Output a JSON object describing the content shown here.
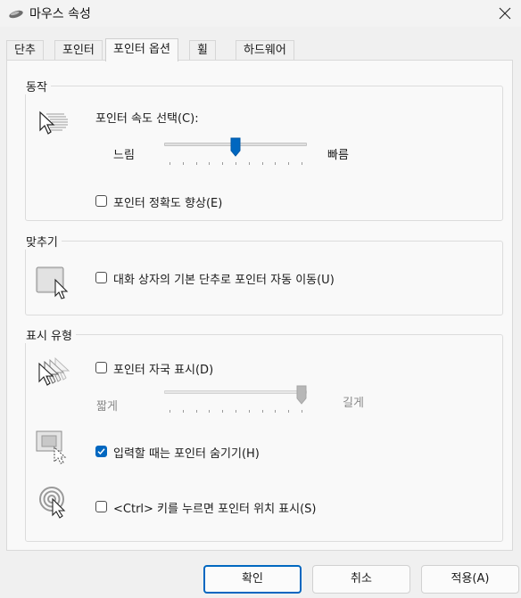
{
  "window": {
    "title": "마우스 속성",
    "title_icon": "mouse-icon",
    "close_icon": "close-icon"
  },
  "tabs": [
    {
      "label": "단추"
    },
    {
      "label": "포인터"
    },
    {
      "label": "포인터 옵션",
      "active": true
    },
    {
      "label": "휠"
    },
    {
      "label": "하드웨어"
    }
  ],
  "motion": {
    "title": "동작",
    "speed_label": "포인터 속도 선택(C):",
    "slow_label": "느림",
    "fast_label": "빠름",
    "speed_level": 0.5,
    "precision_label": "포인터 정확도 향상(E)",
    "precision_checked": false
  },
  "snap_to": {
    "title": "맞추기",
    "label": "대화 상자의 기본 단추로 포인터 자동 이동(U)",
    "checked": false
  },
  "visibility": {
    "title": "표시 유형",
    "trails_label": "포인터 자국 표시(D)",
    "trails_checked": false,
    "short_label": "짧게",
    "long_label": "길게",
    "trails_level": 1.0,
    "hide_label": "입력할 때는 포인터 숨기기(H)",
    "hide_checked": true,
    "ctrl_label": "<Ctrl> 키를 누르면 포인터 위치 표시(S)",
    "ctrl_checked": false
  },
  "buttons": {
    "ok": "확인",
    "cancel": "취소",
    "apply": "적용(A)"
  },
  "colors": {
    "accent": "#0067c0",
    "background": "#f0f0f0",
    "panel": "#f9f9f9"
  }
}
